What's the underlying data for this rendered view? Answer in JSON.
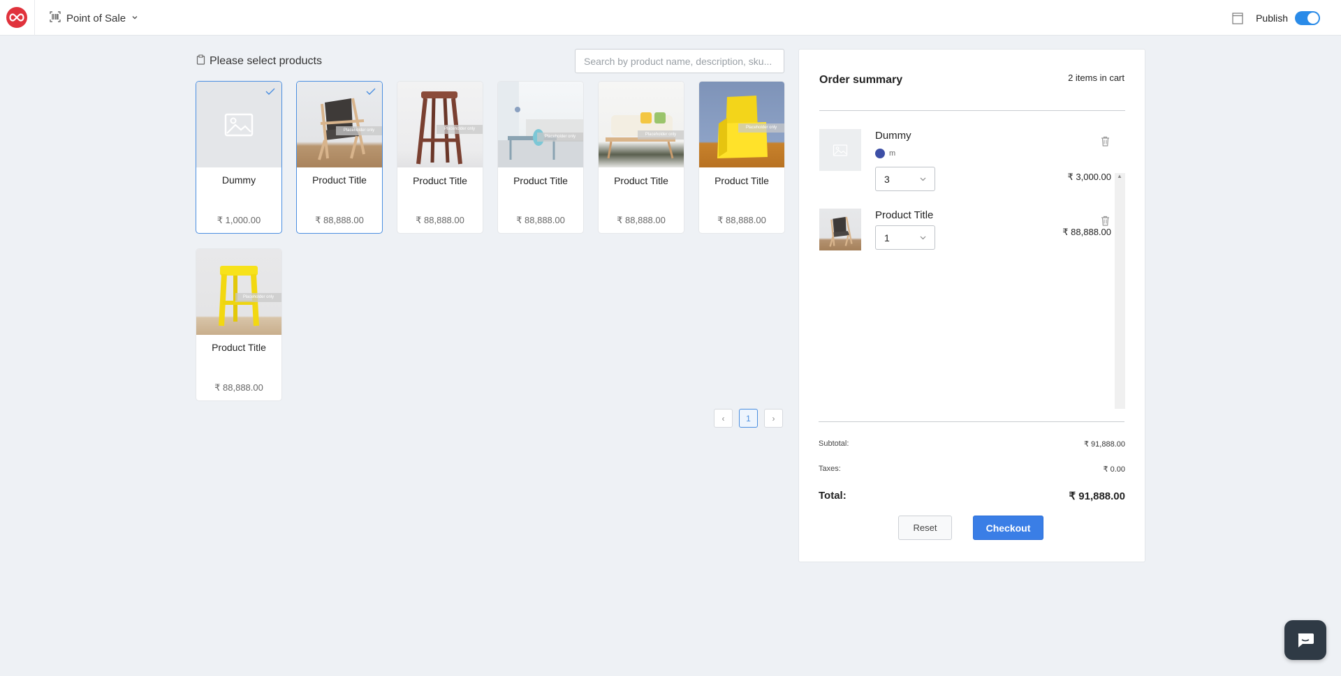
{
  "header": {
    "app_title": "Point of Sale",
    "publish_label": "Publish",
    "publish_enabled": true,
    "accent_color": "#2a8be8",
    "logo_color": "#e0323c"
  },
  "products": {
    "header_label": "Please select products",
    "search_placeholder": "Search by product name, description, sku...",
    "items": [
      {
        "name": "Dummy",
        "price": "₹ 1,000.00",
        "selected": true,
        "image": "placeholder-icon"
      },
      {
        "name": "Product Title",
        "price": "₹ 88,888.00",
        "selected": true,
        "image": "chair-photo"
      },
      {
        "name": "Product Title",
        "price": "₹ 88,888.00",
        "selected": false,
        "image": "stool-photo"
      },
      {
        "name": "Product Title",
        "price": "₹ 88,888.00",
        "selected": false,
        "image": "living-room-photo"
      },
      {
        "name": "Product Title",
        "price": "₹ 88,888.00",
        "selected": false,
        "image": "sofa-photo"
      },
      {
        "name": "Product Title",
        "price": "₹ 88,888.00",
        "selected": false,
        "image": "yellow-armchair-photo"
      },
      {
        "name": "Product Title",
        "price": "₹ 88,888.00",
        "selected": false,
        "image": "yellow-stool-photo"
      }
    ],
    "placeholder_tag": "Placeholder only"
  },
  "pagination": {
    "prev": "‹",
    "current": "1",
    "next": "›"
  },
  "summary": {
    "title": "Order summary",
    "item_count": "2 items in cart",
    "cart": [
      {
        "name": "Dummy",
        "variant": "m",
        "quantity": "3",
        "price": "₹ 3,000.00"
      },
      {
        "name": "Product Title",
        "quantity": "1",
        "price": "₹ 88,888.00"
      }
    ],
    "subtotal_label": "Subtotal:",
    "subtotal_value": "₹ 91,888.00",
    "taxes_label": "Taxes:",
    "taxes_value": "₹ 0.00",
    "total_label": "Total:",
    "total_value": "₹ 91,888.00",
    "reset_label": "Reset",
    "checkout_label": "Checkout"
  }
}
